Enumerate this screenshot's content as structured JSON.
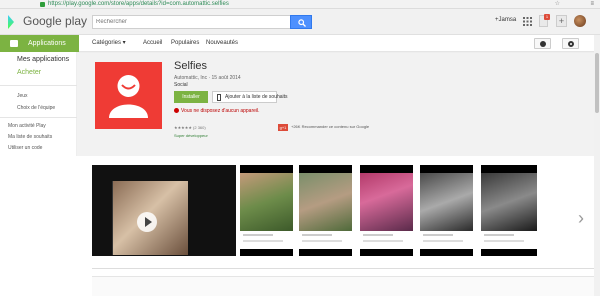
{
  "browser": {
    "url": "https://play.google.com/store/apps/details?id=com.automattic.selfies"
  },
  "header": {
    "logo_text": "Google play",
    "search_placeholder": "Rechercher",
    "user": "+Jamsa",
    "notif_count": "1"
  },
  "nav": {
    "apps_tab": "Applications",
    "links": [
      "Catégories ▾",
      "Accueil",
      "Populaires",
      "Nouveautés"
    ]
  },
  "sidebar": {
    "my_apps": "Mes applications",
    "buy": "Acheter",
    "games": "Jeux",
    "editors": "Choix de l'équipe",
    "play_activity": "Mon activité Play",
    "wishlist": "Ma liste de souhaits",
    "redeem": "Utiliser un code"
  },
  "app": {
    "title": "Selfies",
    "developer": "Automattic, Inc · 15 août 2014",
    "category": "Social",
    "install": "Installer",
    "wishlist": "Ajouter à la liste de souhaits",
    "warning": "Vous ne disposez d'aucun appareil.",
    "rating_text": "★★★★★ (2 360)",
    "top_dev": "Super développeur",
    "plus_count": "+26K  Recommander ce contenu sur Google"
  },
  "colors": {
    "brand_green": "#7cb342",
    "icon_red": "#ef3b35",
    "search_blue": "#4d90fe"
  }
}
